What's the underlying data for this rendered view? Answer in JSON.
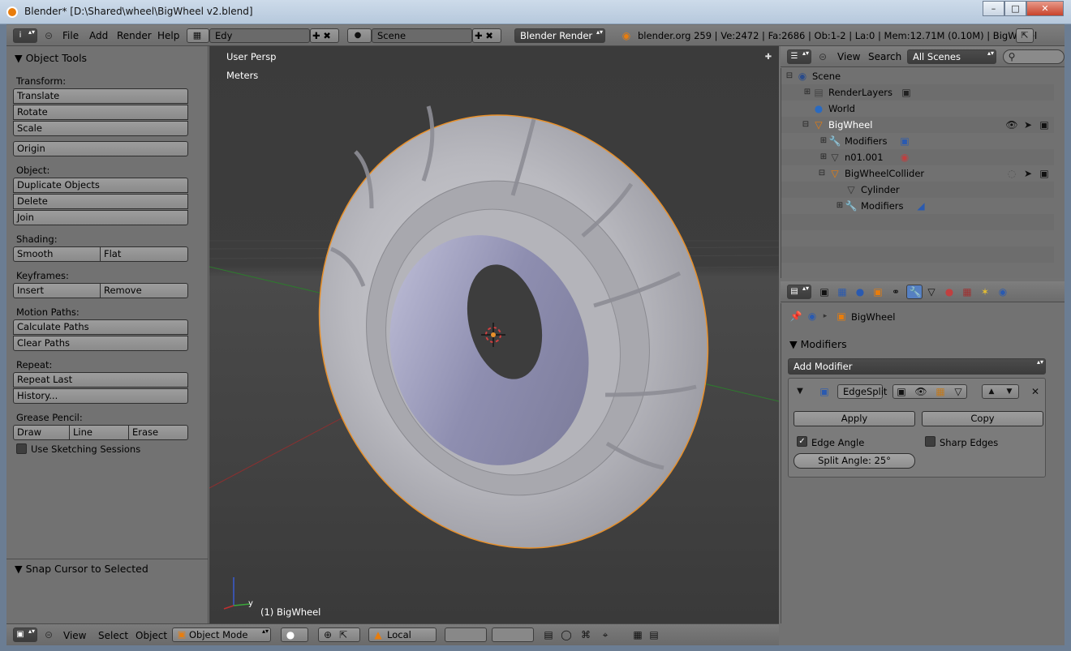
{
  "window": {
    "title": "Blender* [D:\\Shared\\wheel\\BigWheel v2.blend]"
  },
  "info_header": {
    "menus": [
      "File",
      "Add",
      "Render",
      "Help"
    ],
    "layout": "Edy",
    "scene": "Scene",
    "engine": "Blender Render",
    "stats": "blender.org 259 | Ve:2472 | Fa:2686 | Ob:1-2 | La:0 | Mem:12.71M (0.10M) | BigWheel"
  },
  "tool_shelf": {
    "title": "Object Tools",
    "transform_label": "Transform:",
    "translate": "Translate",
    "rotate": "Rotate",
    "scale": "Scale",
    "origin": "Origin",
    "object_label": "Object:",
    "duplicate": "Duplicate Objects",
    "delete": "Delete",
    "join": "Join",
    "shading_label": "Shading:",
    "smooth": "Smooth",
    "flat": "Flat",
    "keyframes_label": "Keyframes:",
    "insert": "Insert",
    "remove": "Remove",
    "motion_label": "Motion Paths:",
    "calc_paths": "Calculate Paths",
    "clear_paths": "Clear Paths",
    "repeat_label": "Repeat:",
    "repeat_last": "Repeat Last",
    "history": "History...",
    "grease_label": "Grease Pencil:",
    "draw": "Draw",
    "line": "Line",
    "erase": "Erase",
    "sketch": "Use Sketching Sessions",
    "operator_title": "Snap Cursor to Selected"
  },
  "viewport": {
    "view_name": "User Persp",
    "units": "Meters",
    "object_label": "(1) BigWheel",
    "axis_y": "y"
  },
  "viewport_header": {
    "menus": [
      "View",
      "Select",
      "Object"
    ],
    "mode": "Object Mode",
    "orientation": "Local"
  },
  "outliner": {
    "menus": [
      "View",
      "Search"
    ],
    "display": "All Scenes",
    "rows": [
      {
        "label": "Scene"
      },
      {
        "label": "RenderLayers"
      },
      {
        "label": "World"
      },
      {
        "label": "BigWheel"
      },
      {
        "label": "Modifiers"
      },
      {
        "label": "n01.001"
      },
      {
        "label": "BigWheelCollider"
      },
      {
        "label": "Cylinder"
      },
      {
        "label": "Modifiers"
      }
    ]
  },
  "properties": {
    "context": "BigWheel",
    "panel_title": "Modifiers",
    "add_modifier": "Add Modifier",
    "modifier_name": "EdgeSplit",
    "apply": "Apply",
    "copy": "Copy",
    "edge_angle": "Edge Angle",
    "sharp_edges": "Sharp Edges",
    "split_angle": "Split Angle: 25°"
  },
  "colors": {
    "accent": "#e87d0d",
    "selection": "#5680c2",
    "viewport_bg": "#3d3d3d"
  }
}
